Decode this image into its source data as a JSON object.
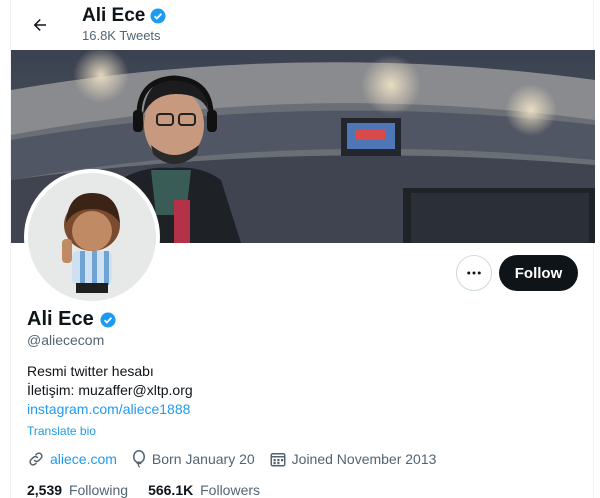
{
  "header": {
    "name": "Ali Ece",
    "tweet_count": "16.8K Tweets"
  },
  "profile": {
    "name": "Ali Ece",
    "handle": "@aliececom",
    "bio_line1": "Resmi twitter hesabı",
    "bio_line2": "İletişim: muzaffer@xltp.org",
    "bio_link": "instagram.com/aliece1888",
    "translate_label": "Translate bio",
    "website": "aliece.com",
    "birthday": "Born January 20",
    "joined": "Joined November 2013",
    "following_count": "2,539",
    "following_label": "Following",
    "followers_count": "566.1K",
    "followers_label": "Followers"
  },
  "actions": {
    "follow_label": "Follow"
  },
  "colors": {
    "accent": "#1d9bf0",
    "text": "#0f1419",
    "muted": "#536471"
  },
  "icons": [
    "back-arrow-icon",
    "verified-badge-icon",
    "more-icon",
    "link-icon",
    "balloon-icon",
    "calendar-icon"
  ]
}
